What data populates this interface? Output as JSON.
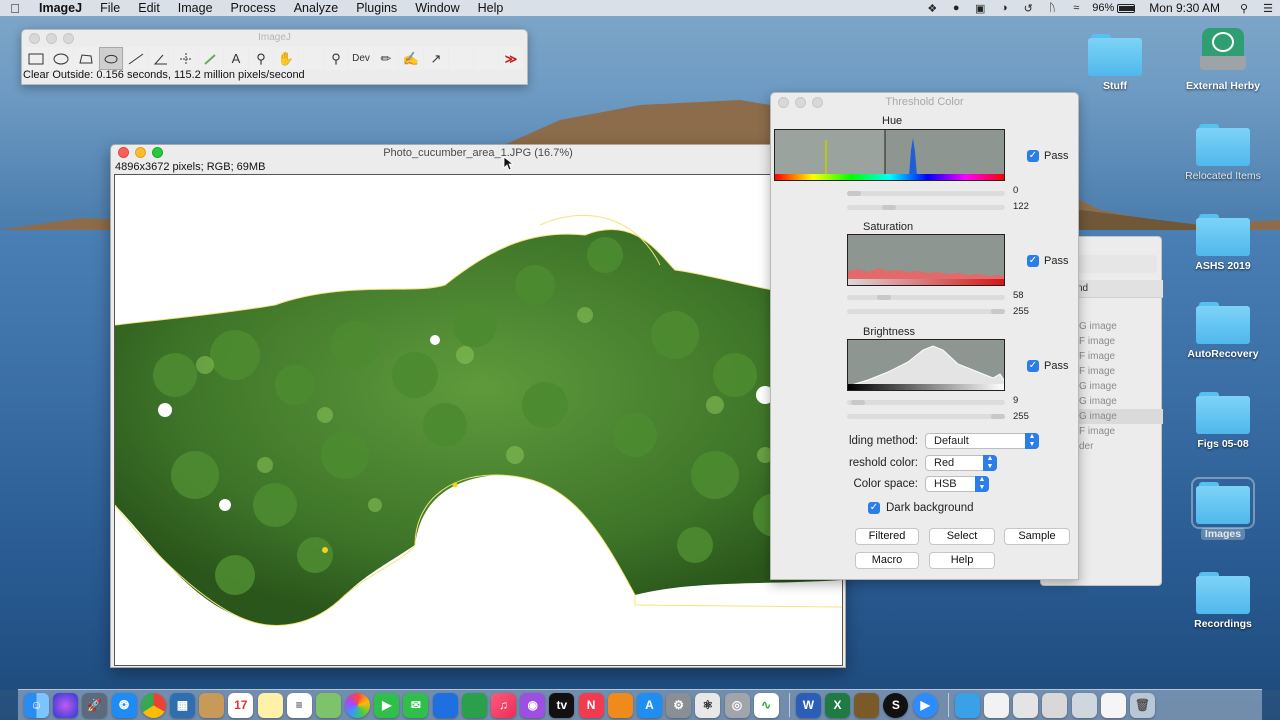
{
  "menubar": {
    "app": "ImageJ",
    "items": [
      "File",
      "Edit",
      "Image",
      "Process",
      "Analyze",
      "Plugins",
      "Window",
      "Help"
    ],
    "battery": "96%",
    "clock": "Mon 9:30 AM"
  },
  "imagej_window": {
    "title": "ImageJ",
    "tools": [
      "rectangle",
      "oval",
      "polygon",
      "freehand",
      "straight-line",
      "angle",
      "multi-point",
      "wand",
      "text",
      "magnifier",
      "scroll",
      "color-picker",
      "zoom",
      "dev",
      "pencil",
      "brush",
      "flood-fill"
    ],
    "dev_label": "Dev",
    "more_label": "≫",
    "status": "Clear Outside: 0.156 seconds, 115.2 million pixels/second"
  },
  "image_window": {
    "title": "Photo_cucumber_area_1.JPG (16.7%)",
    "info": "4896x3672 pixels; RGB; 69MB"
  },
  "threshold_window": {
    "title": "Threshold Color",
    "hue": {
      "label": "Hue",
      "pass": "Pass",
      "min": "0",
      "max": "122"
    },
    "saturation": {
      "label": "Saturation",
      "pass": "Pass",
      "min": "58",
      "max": "255"
    },
    "brightness": {
      "label": "Brightness",
      "pass": "Pass",
      "min": "9",
      "max": "255"
    },
    "method": {
      "label": "lding method:",
      "value": "Default"
    },
    "color": {
      "label": "reshold color:",
      "value": "Red"
    },
    "space": {
      "label": "Color space:",
      "value": "HSB"
    },
    "dark_bg": "Dark background",
    "buttons": {
      "filtered": "Filtered",
      "select": "Select",
      "sample": "Sample",
      "macro": "Macro",
      "help": "Help"
    },
    "accent": "#2b7de9"
  },
  "background_window": {
    "header": "nd",
    "items": [
      "G image",
      "F image",
      "F image",
      "F image",
      "G image",
      "G image",
      "G image",
      "F image",
      "der"
    ]
  },
  "desktop": {
    "icons": [
      {
        "name": "Stuff"
      },
      {
        "name": "External Herby"
      },
      {
        "name": "Relocated Items"
      },
      {
        "name": "ASHS 2019"
      },
      {
        "name": "AutoRecovery"
      },
      {
        "name": "Figs 05-08"
      },
      {
        "name": "Images"
      },
      {
        "name": "Recordings"
      }
    ]
  },
  "dock": {
    "apps": [
      "finder",
      "siri",
      "launchpad",
      "safari",
      "chrome",
      "preview",
      "files",
      "calendar",
      "notes",
      "reminders",
      "maps",
      "photos",
      "facetime",
      "messages",
      "keynote",
      "numbers",
      "music",
      "podcasts",
      "tv",
      "news",
      "books",
      "app-store",
      "system-preferences",
      "imagej",
      "quicktime",
      "activity-monitor",
      "word",
      "excel",
      "instruments",
      "skype",
      "zoom-app"
    ],
    "word_label": "W",
    "excel_label": "X",
    "folders": [
      "downloads",
      "documents-stack",
      "stack-1",
      "stack-2",
      "stack-3",
      "stack-4"
    ]
  }
}
